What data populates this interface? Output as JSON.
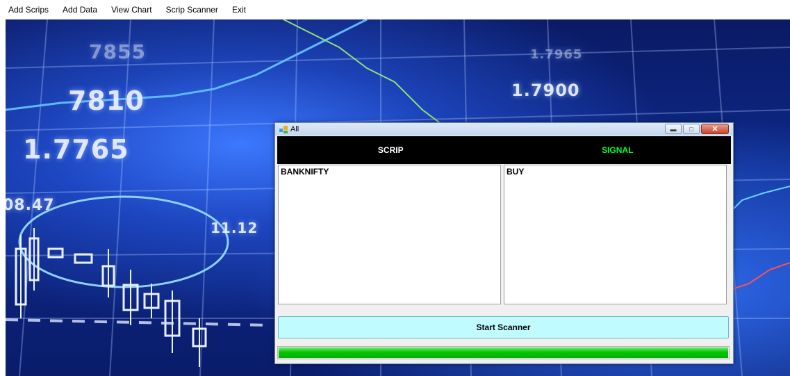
{
  "menu": {
    "items": [
      "Add Scrips",
      "Add Data",
      "View Chart",
      "Scrip Scanner",
      "Exit"
    ]
  },
  "background": {
    "numbers": [
      "7855",
      "7810",
      "1.7765",
      "08.47",
      "11.12",
      "1.7900",
      "1.7965"
    ]
  },
  "window": {
    "title": "All",
    "header": {
      "scrip": "SCRIP",
      "signal": "SIGNAL"
    },
    "scrips": [
      "BANKNIFTY"
    ],
    "signals": [
      "BUY"
    ],
    "start_button": "Start Scanner",
    "progress": 1.0
  },
  "colors": {
    "signal_header": "#00ff2a",
    "start_button_bg": "#c0fbff",
    "progress_fill": "#06c406",
    "header_bg": "#000000"
  }
}
